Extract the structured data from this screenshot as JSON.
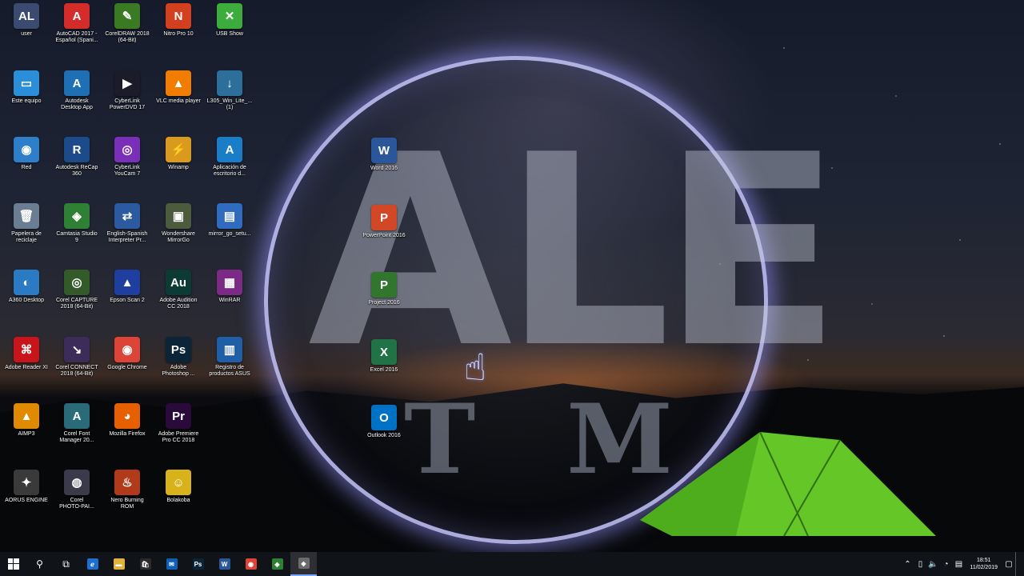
{
  "colors": {
    "accent": "#7aa7ff",
    "taskbar": "#101318",
    "logo_ring": "#c8c8ff",
    "tent_green": "#6fdc2a"
  },
  "logo": {
    "main": "ALE",
    "sub": "T M"
  },
  "desktop_icons": [
    {
      "label": "user",
      "glyph": "AL",
      "icon": "user-icon",
      "bg": "#3b4a70"
    },
    {
      "label": "AutoCAD 2017 -\nEspañol (Spani...",
      "glyph": "A",
      "icon": "autocad-icon",
      "bg": "#d42b2b"
    },
    {
      "label": "CorelDRAW 2018\n(64-Bit)",
      "glyph": "✎",
      "icon": "coreldraw-icon",
      "bg": "#3a7a22"
    },
    {
      "label": "Nitro Pro 10",
      "glyph": "N",
      "icon": "nitro-pro-icon",
      "bg": "#d3401f"
    },
    {
      "label": "USB Show",
      "glyph": "✕",
      "icon": "usb-show-icon",
      "bg": "#3cad3c"
    },
    {
      "label": "Este equipo",
      "glyph": "▭",
      "icon": "computer-icon",
      "bg": "#2a8fd8"
    },
    {
      "label": "Autodesk\nDesktop App",
      "glyph": "A",
      "icon": "autodesk-icon",
      "bg": "#1f6fb5"
    },
    {
      "label": "CyberLink\nPowerDVD 17",
      "glyph": "▶",
      "icon": "powerdvd-icon",
      "bg": "#1b1b2a"
    },
    {
      "label": "VLC media player",
      "glyph": "▲",
      "icon": "vlc-icon",
      "bg": "#f07d00"
    },
    {
      "label": "L305_Win_Lite_...\n(1)",
      "glyph": "↓",
      "icon": "download-icon",
      "bg": "#2c6f9a"
    },
    {
      "label": "Red",
      "glyph": "◉",
      "icon": "network-icon",
      "bg": "#2d7fc9"
    },
    {
      "label": "Autodesk ReCap\n360",
      "glyph": "R",
      "icon": "recap-icon",
      "bg": "#1d4b8a"
    },
    {
      "label": "CyberLink\nYouCam 7",
      "glyph": "◎",
      "icon": "youcam-icon",
      "bg": "#7a2fb8"
    },
    {
      "label": "Winamp",
      "glyph": "⚡",
      "icon": "winamp-icon",
      "bg": "#d99a1d"
    },
    {
      "label": "Aplicación de\nescritorio d...",
      "glyph": "A",
      "icon": "autodesk-app-icon",
      "bg": "#1a7dc8"
    },
    {
      "label": "Papelera de\nreciclaje",
      "glyph": "🗑",
      "icon": "recycle-bin-icon",
      "bg": "#6a7d92"
    },
    {
      "label": "Camtasia Studio\n9",
      "glyph": "◈",
      "icon": "camtasia-icon",
      "bg": "#2f7f34"
    },
    {
      "label": "English-Spanish\nInterpreter Pr...",
      "glyph": "⇄",
      "icon": "interpreter-icon",
      "bg": "#2c5aa0"
    },
    {
      "label": "Wondershare\nMirrorGo",
      "glyph": "▣",
      "icon": "mirrorgo-icon",
      "bg": "#4c5b3b"
    },
    {
      "label": "mirror_go_setu...",
      "glyph": "▤",
      "icon": "setup-icon",
      "bg": "#2f6bbf"
    },
    {
      "label": "A360 Desktop",
      "glyph": "◐",
      "icon": "a360-icon",
      "bg": "#2a7bc4"
    },
    {
      "label": "Corel CAPTURE\n2018 (64-Bit)",
      "glyph": "◎",
      "icon": "corel-capture-icon",
      "bg": "#335b2a"
    },
    {
      "label": "Epson Scan 2",
      "glyph": "▲",
      "icon": "epson-scan-icon",
      "bg": "#1f3fa0"
    },
    {
      "label": "Adobe Audition\nCC 2018",
      "glyph": "Au",
      "icon": "audition-icon",
      "bg": "#0b3b34"
    },
    {
      "label": "WinRAR",
      "glyph": "▦",
      "icon": "winrar-icon",
      "bg": "#7b2a86"
    },
    {
      "label": "Adobe Reader XI",
      "glyph": "⌘",
      "icon": "adobe-reader-icon",
      "bg": "#c8151b"
    },
    {
      "label": "Corel CONNECT\n2018 (64-Bit)",
      "glyph": "↘",
      "icon": "corel-connect-icon",
      "bg": "#3b2c5a"
    },
    {
      "label": "Google Chrome",
      "glyph": "◉",
      "icon": "chrome-icon",
      "bg": "#db4437"
    },
    {
      "label": "Adobe\nPhotoshop ...",
      "glyph": "Ps",
      "icon": "photoshop-icon",
      "bg": "#0b2438"
    },
    {
      "label": "Registro de\nproductos ASUS",
      "glyph": "▥",
      "icon": "asus-icon",
      "bg": "#1f5fa8"
    },
    {
      "label": "AIMP3",
      "glyph": "▲",
      "icon": "aimp-icon",
      "bg": "#e08a00"
    },
    {
      "label": "Corel Font\nManager 20...",
      "glyph": "A",
      "icon": "corel-font-icon",
      "bg": "#2a6b7a"
    },
    {
      "label": "Mozilla Firefox",
      "glyph": "◕",
      "icon": "firefox-icon",
      "bg": "#e66000"
    },
    {
      "label": "Adobe Premiere\nPro CC 2018",
      "glyph": "Pr",
      "icon": "premiere-icon",
      "bg": "#2a0a3a"
    },
    {
      "label": "AORUS ENGINE",
      "glyph": "✦",
      "icon": "aorus-icon",
      "bg": "#3a3a3a"
    },
    {
      "label": "Corel\nPHOTO-PAI...",
      "glyph": "◍",
      "icon": "photo-paint-icon",
      "bg": "#3a3a4a"
    },
    {
      "label": "Nero Burning\nROM",
      "glyph": "♨",
      "icon": "nero-icon",
      "bg": "#b03a1a"
    },
    {
      "label": "Bolakoba",
      "glyph": "☺",
      "icon": "bolakoba-icon",
      "bg": "#d8b21a"
    }
  ],
  "office_icons": [
    {
      "label": "Word 2016",
      "glyph": "W",
      "icon": "word-icon",
      "bg": "#2b579a"
    },
    {
      "label": "PowerPoint 2016",
      "glyph": "P",
      "icon": "powerpoint-icon",
      "bg": "#d24726"
    },
    {
      "label": "Project 2016",
      "glyph": "P",
      "icon": "project-icon",
      "bg": "#31752f"
    },
    {
      "label": "Excel 2016",
      "glyph": "X",
      "icon": "excel-icon",
      "bg": "#217346"
    },
    {
      "label": "Outlook 2016",
      "glyph": "O",
      "icon": "outlook-icon",
      "bg": "#0072c6"
    }
  ],
  "taskbar": {
    "pinned": [
      {
        "glyph": "ℯ",
        "icon": "edge-icon",
        "bg": "#1e6fd0"
      },
      {
        "glyph": "▬",
        "icon": "file-explorer-icon",
        "bg": "#e2b33b"
      },
      {
        "glyph": "🛍",
        "icon": "store-icon",
        "bg": "#2b2b2b"
      },
      {
        "glyph": "✉",
        "icon": "mail-icon",
        "bg": "#0f5fb5"
      },
      {
        "glyph": "Ps",
        "icon": "photoshop-taskbar-icon",
        "bg": "#0b2438"
      },
      {
        "glyph": "W",
        "icon": "word-taskbar-icon",
        "bg": "#2b579a"
      },
      {
        "glyph": "◉",
        "icon": "chrome-taskbar-icon",
        "bg": "#db4437"
      },
      {
        "glyph": "◈",
        "icon": "camtasia-taskbar-icon",
        "bg": "#2f7f34"
      },
      {
        "glyph": "◈",
        "icon": "camtasia-recorder-taskbar-icon",
        "bg": "#6b6b6b"
      }
    ],
    "clock_time": "18:51",
    "clock_date": "11/02/2019"
  }
}
